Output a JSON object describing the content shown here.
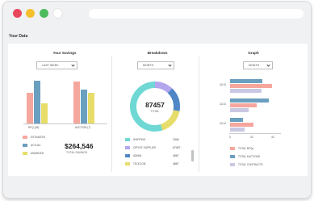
{
  "page": {
    "title": "Your Data"
  },
  "colors": {
    "teal": "#6fd8d4",
    "purple": "#b3a6ef",
    "blue": "#4f86c6",
    "yellow": "#e7dd6a",
    "salmon": "#f6a79d",
    "steel": "#6b9fc0",
    "lavender": "#c9c9e4"
  },
  "savings": {
    "title": "Your Savings",
    "dropdown": "LAST WEEK",
    "categories": [
      "RFQ (28)",
      "AUCTION (7)"
    ],
    "series": [
      {
        "name": "ESTIMATED",
        "values": [
          38,
          52
        ]
      },
      {
        "name": "ACTUAL",
        "values": [
          53,
          42
        ]
      },
      {
        "name": "AWARDED",
        "values": [
          25,
          38
        ]
      }
    ],
    "total_value": "$264,546",
    "total_label": "TOTAL SAVINGS"
  },
  "breakdown": {
    "title": "Breakdown",
    "dropdown": "MONTH",
    "total_value": "87457",
    "total_label": "TOTAL",
    "items": [
      {
        "label": "SHIPPING",
        "value": "2346"
      },
      {
        "label": "OFFICE SUPPLIES",
        "value": "67457"
      },
      {
        "label": "ADMIN",
        "value": "4567"
      },
      {
        "label": "TELECOM",
        "value": "4867"
      }
    ],
    "chart_data": {
      "type": "pie",
      "labels": [
        "SHIPPING",
        "OFFICE SUPPLIES",
        "ADMIN",
        "TELECOM"
      ],
      "values": [
        0.55,
        0.12,
        0.16,
        0.17
      ]
    }
  },
  "graph": {
    "title": "Graph",
    "dropdown": "MONTH",
    "chart_data": {
      "type": "bar",
      "orientation": "horizontal",
      "categories": [
        "11/13",
        "11/13",
        "11/14"
      ],
      "xticks": [
        "0",
        "20",
        "40"
      ],
      "xlim": [
        0,
        40
      ],
      "series": [
        {
          "name": "TOTAL RFQs",
          "values": [
            40,
            25,
            22
          ]
        },
        {
          "name": "TOTAL AUCTIONS",
          "values": [
            31,
            37,
            12
          ]
        },
        {
          "name": "TOTAL CONTRACTS",
          "values": [
            30,
            18,
            14
          ]
        }
      ]
    }
  }
}
